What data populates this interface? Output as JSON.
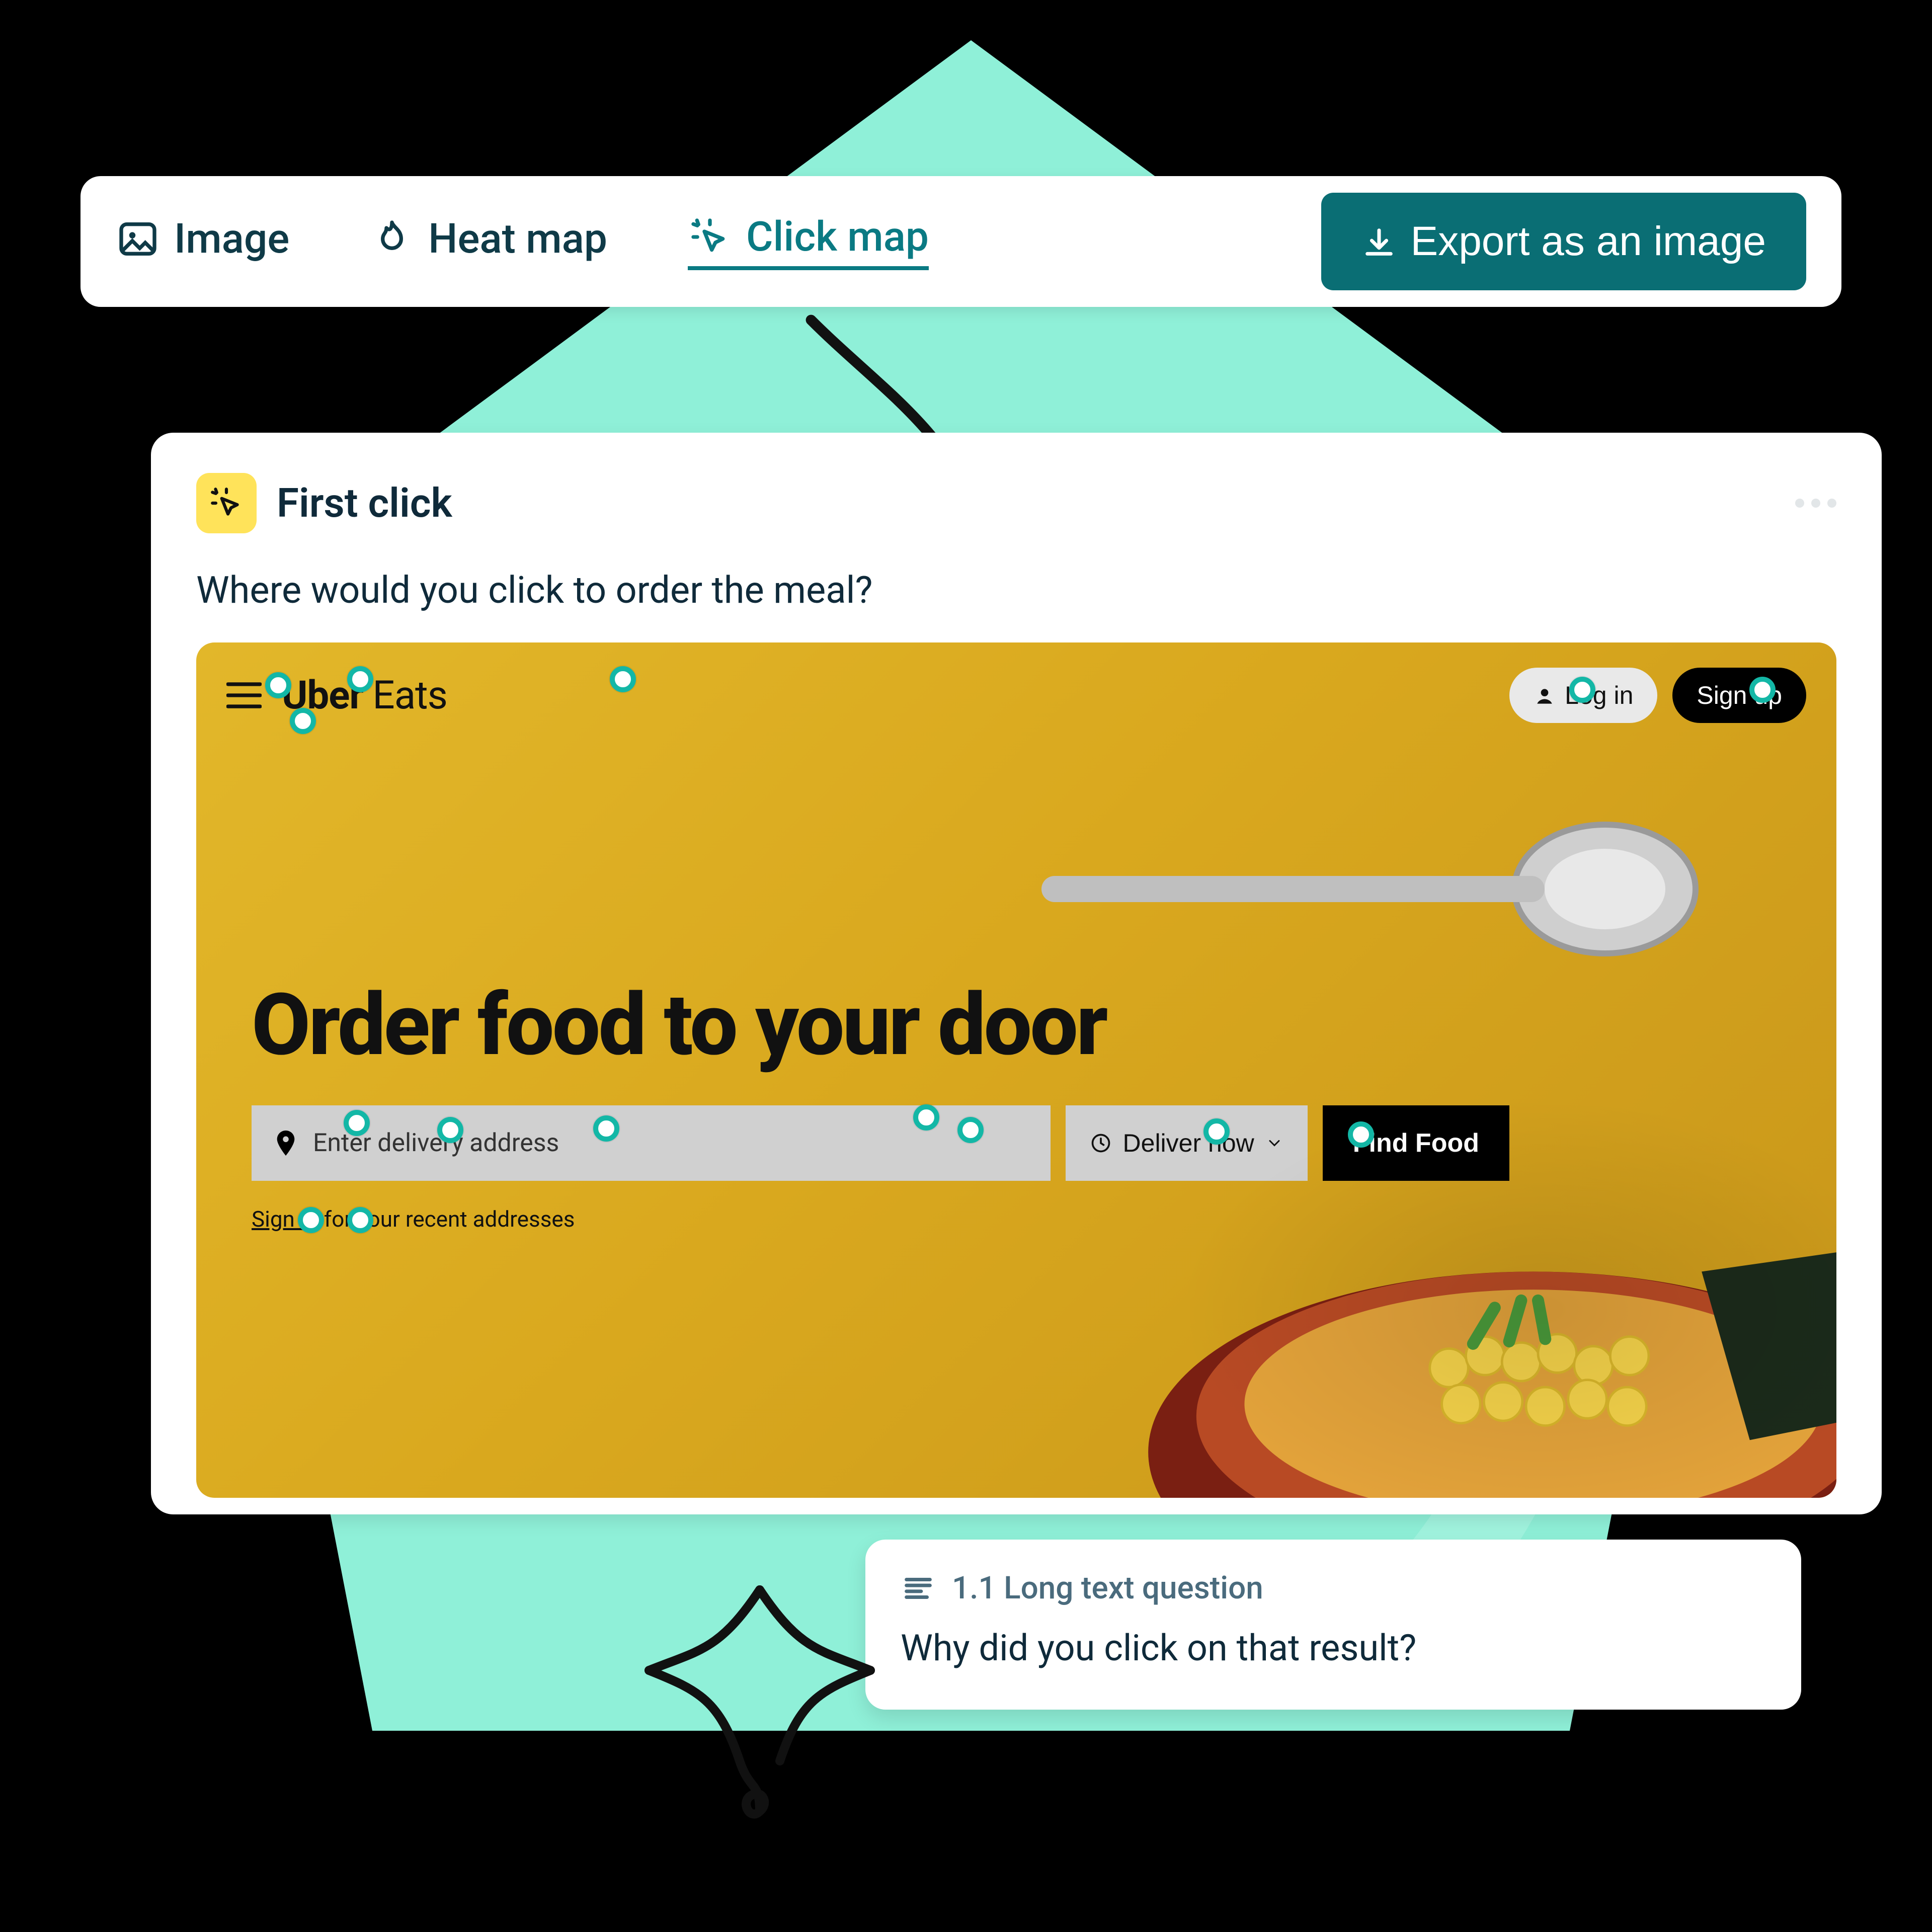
{
  "toolbar": {
    "tabs": {
      "image": "Image",
      "heatmap": "Heat map",
      "clickmap": "Click map"
    },
    "active_tab": "clickmap",
    "export_label": "Export as an image"
  },
  "card": {
    "badge_label": "First click",
    "prompt": "Where would you click to order the meal?"
  },
  "site": {
    "brand_a": "Uber",
    "brand_b": "Eats",
    "login_label": "Log in",
    "signup_label": "Sign up",
    "headline": "Order food to your door",
    "address_placeholder": "Enter delivery address",
    "deliver_now_label": "Deliver now",
    "find_food_label": "Find Food",
    "signin_text_a": "Sign In",
    "signin_text_b": " for your recent addresses"
  },
  "followup": {
    "label": "1.1 Long text question",
    "question": "Why did you click on that result?"
  },
  "click_points_pct": [
    [
      5.0,
      5.0
    ],
    [
      6.5,
      9.2
    ],
    [
      10.0,
      4.3
    ],
    [
      26.0,
      4.3
    ],
    [
      84.5,
      5.5
    ],
    [
      95.5,
      5.5
    ],
    [
      9.8,
      56.2
    ],
    [
      15.5,
      57.0
    ],
    [
      25.0,
      56.8
    ],
    [
      44.5,
      55.5
    ],
    [
      47.2,
      57.0
    ],
    [
      62.2,
      57.2
    ],
    [
      71.0,
      57.5
    ],
    [
      7.0,
      67.5
    ],
    [
      10.0,
      67.5
    ]
  ],
  "colors": {
    "teal_bg": "#8ff0d8",
    "teal_accent": "#0a6e74",
    "tab_active": "#0a7a83",
    "badge_yellow": "#ffe35a",
    "dot_ring": "#13b7a6"
  }
}
